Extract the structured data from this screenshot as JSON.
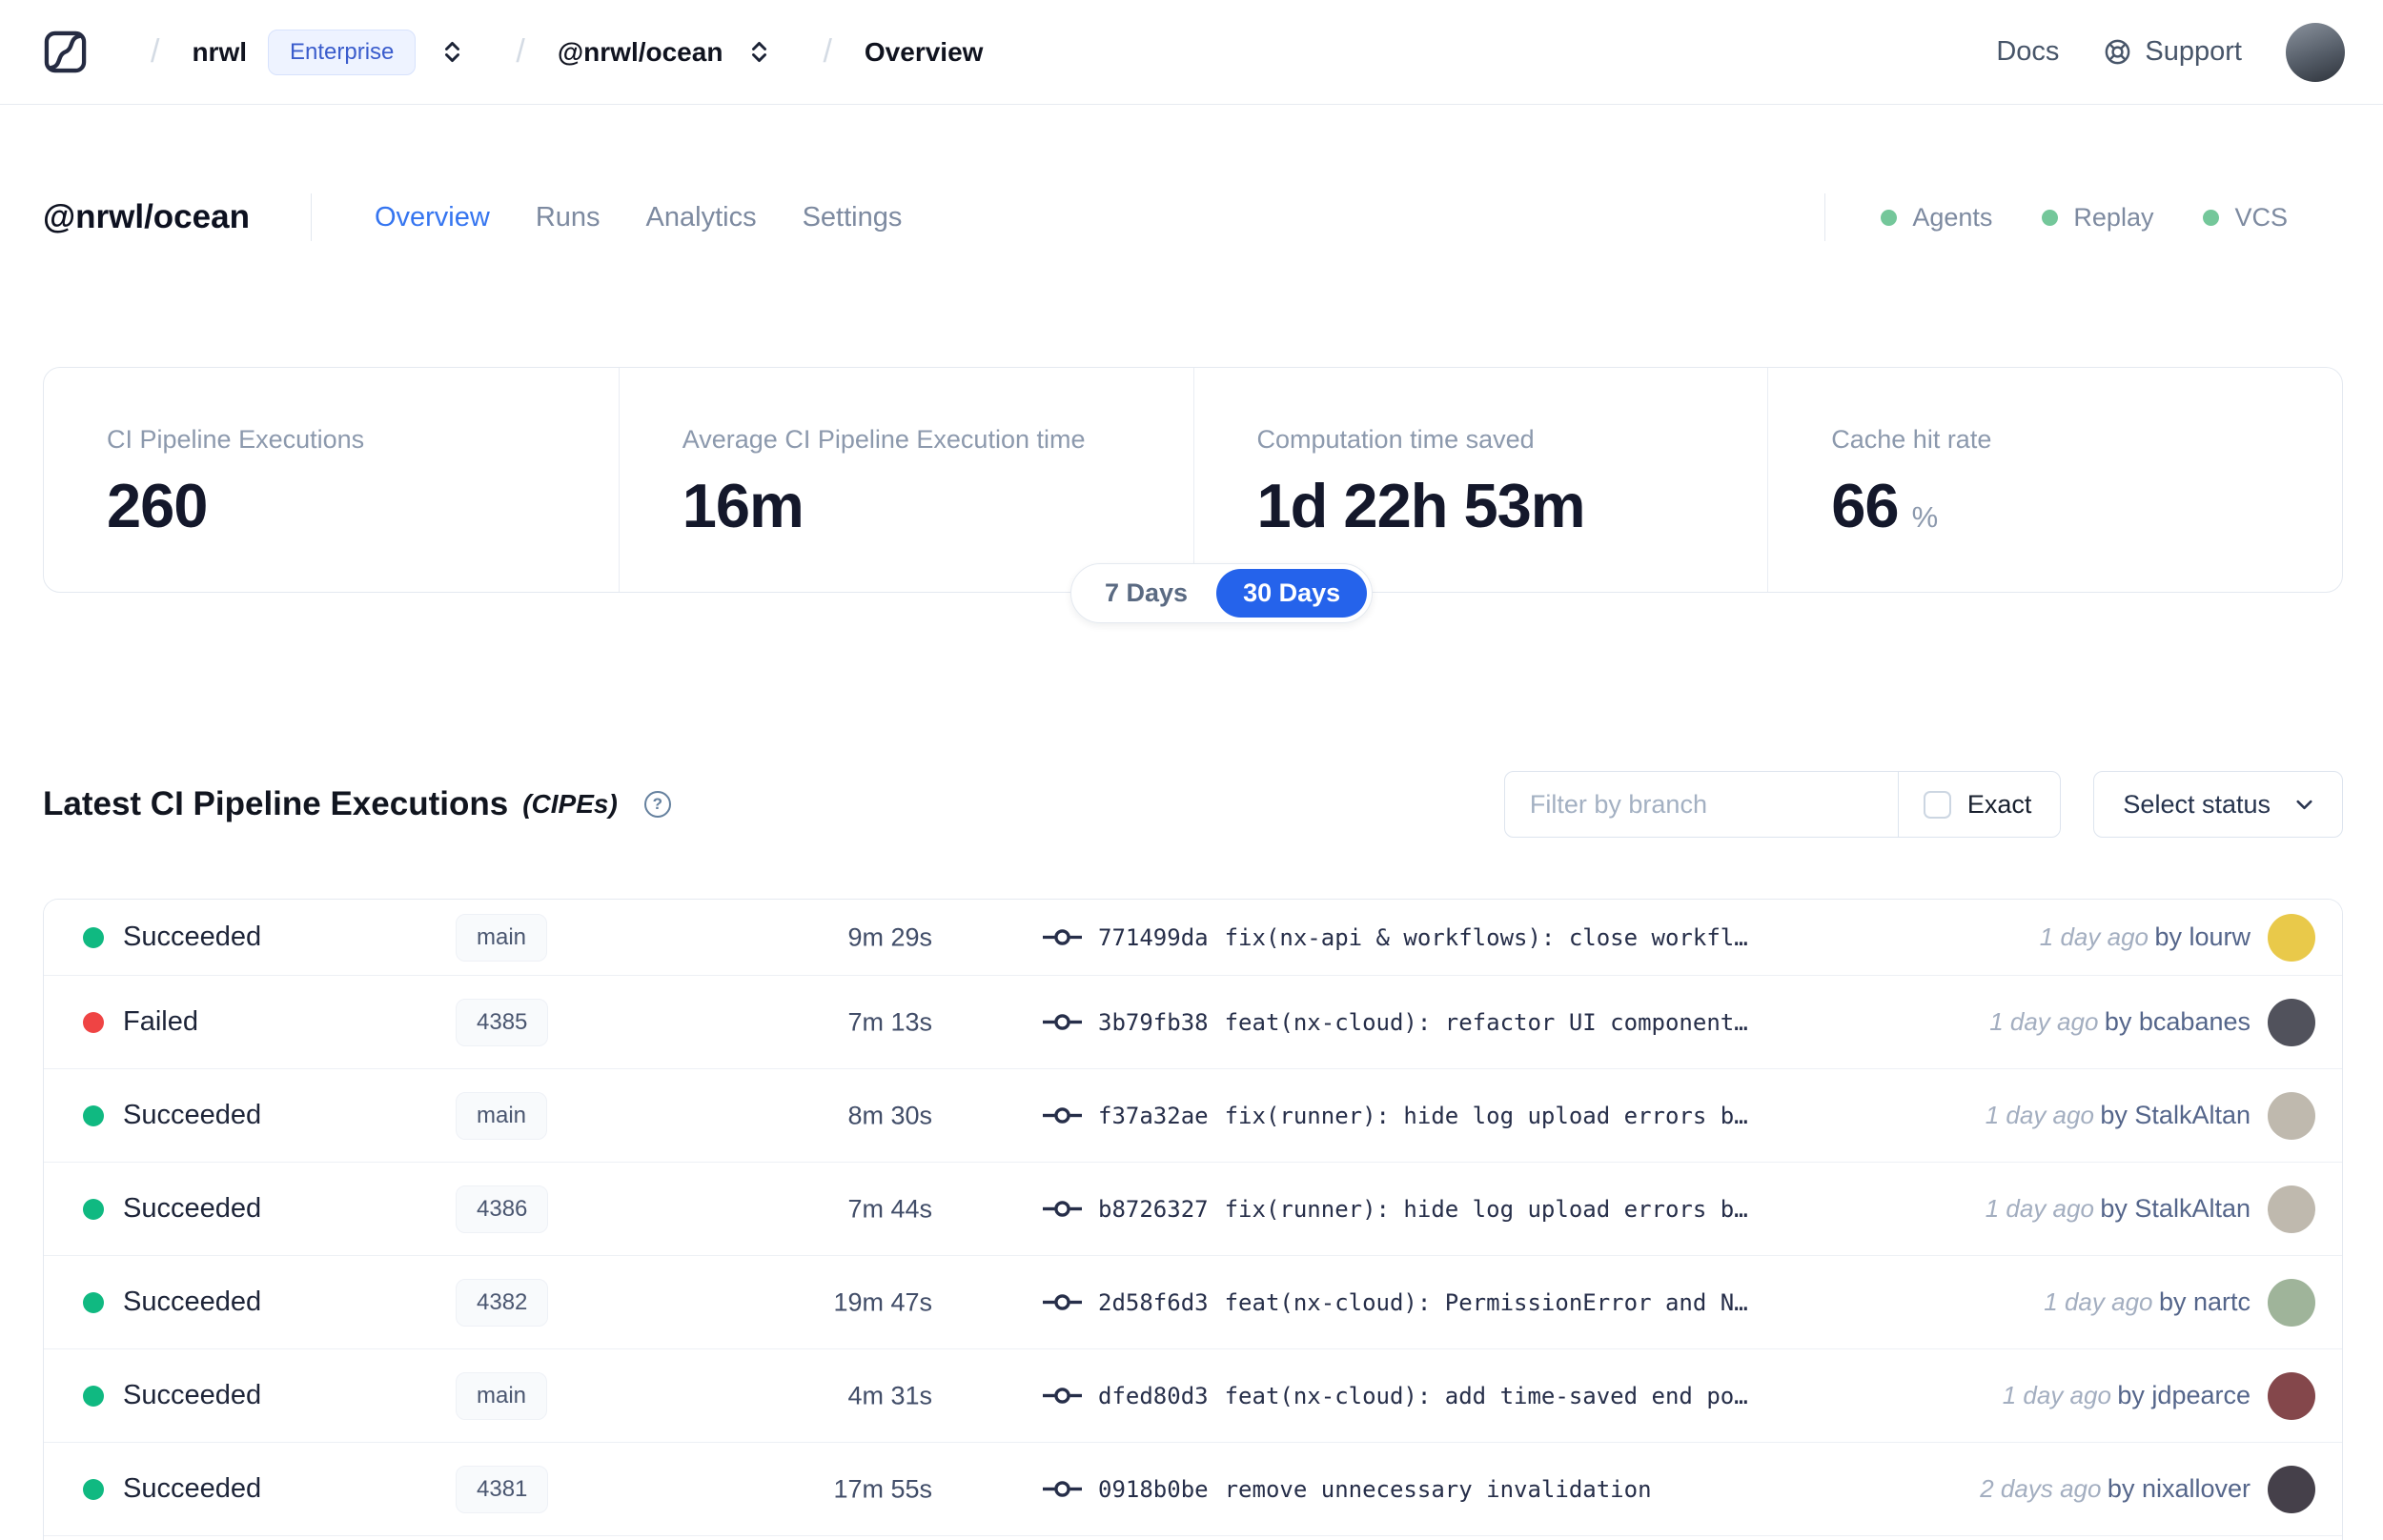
{
  "header": {
    "breadcrumb": {
      "separator": "/",
      "org": "nrwl",
      "org_badge": "Enterprise",
      "workspace": "@nrwl/ocean",
      "page": "Overview"
    },
    "docs_label": "Docs",
    "support_label": "Support"
  },
  "workspace": {
    "title": "@nrwl/ocean",
    "tabs": [
      {
        "label": "Overview"
      },
      {
        "label": "Runs"
      },
      {
        "label": "Analytics"
      },
      {
        "label": "Settings"
      }
    ],
    "active_tab": "Overview",
    "services": [
      {
        "label": "Agents",
        "status_color": "#74c79a"
      },
      {
        "label": "Replay",
        "status_color": "#74c79a"
      },
      {
        "label": "VCS",
        "status_color": "#74c79a"
      }
    ]
  },
  "stats": {
    "cards": [
      {
        "label": "CI Pipeline Executions",
        "value": "260",
        "unit": ""
      },
      {
        "label": "Average CI Pipeline Execution time",
        "value": "16m",
        "unit": ""
      },
      {
        "label": "Computation time saved",
        "value": "1d 22h 53m",
        "unit": ""
      },
      {
        "label": "Cache hit rate",
        "value": "66",
        "unit": "%"
      }
    ],
    "period_toggle": {
      "inactive": "7 Days",
      "active": "30 Days",
      "active_color": "#2563eb"
    }
  },
  "executions": {
    "title": "Latest CI Pipeline Executions",
    "title_suffix": "(CIPEs)",
    "help_glyph": "?",
    "filter": {
      "branch_placeholder": "Filter by branch",
      "exact_label": "Exact",
      "status_label": "Select status"
    },
    "status_colors": {
      "succeeded": "#10b981",
      "failed": "#ef4444"
    },
    "rows": [
      {
        "status": "Succeeded",
        "status_color": "#10b981",
        "branch": "main",
        "duration": "9m 29s",
        "hash": "771499da",
        "message": "fix(nx-api & workflows): close workfl…",
        "time": "1 day ago",
        "author": "by lourw",
        "avatar_color": "#e9c94a"
      },
      {
        "status": "Failed",
        "status_color": "#ef4444",
        "branch": "4385",
        "duration": "7m 13s",
        "hash": "3b79fb38",
        "message": "feat(nx-cloud): refactor UI component…",
        "time": "1 day ago",
        "author": "by bcabanes",
        "avatar_color": "#51525c"
      },
      {
        "status": "Succeeded",
        "status_color": "#10b981",
        "branch": "main",
        "duration": "8m 30s",
        "hash": "f37a32ae",
        "message": "fix(runner): hide log upload errors b…",
        "time": "1 day ago",
        "author": "by StalkAltan",
        "avatar_color": "#bfb9ae"
      },
      {
        "status": "Succeeded",
        "status_color": "#10b981",
        "branch": "4386",
        "duration": "7m 44s",
        "hash": "b8726327",
        "message": "fix(runner): hide log upload errors b…",
        "time": "1 day ago",
        "author": "by StalkAltan",
        "avatar_color": "#bfb9ae"
      },
      {
        "status": "Succeeded",
        "status_color": "#10b981",
        "branch": "4382",
        "duration": "19m 47s",
        "hash": "2d58f6d3",
        "message": "feat(nx-cloud): PermissionError and N…",
        "time": "1 day ago",
        "author": "by nartc",
        "avatar_color": "#9fb49a"
      },
      {
        "status": "Succeeded",
        "status_color": "#10b981",
        "branch": "main",
        "duration": "4m 31s",
        "hash": "dfed80d3",
        "message": "feat(nx-cloud): add time-saved end po…",
        "time": "1 day ago",
        "author": "by jdpearce",
        "avatar_color": "#84474b"
      },
      {
        "status": "Succeeded",
        "status_color": "#10b981",
        "branch": "4381",
        "duration": "17m 55s",
        "hash": "0918b0be",
        "message": "remove unnecessary invalidation",
        "time": "2 days ago",
        "author": "by nixallover",
        "avatar_color": "#45404a"
      }
    ]
  }
}
